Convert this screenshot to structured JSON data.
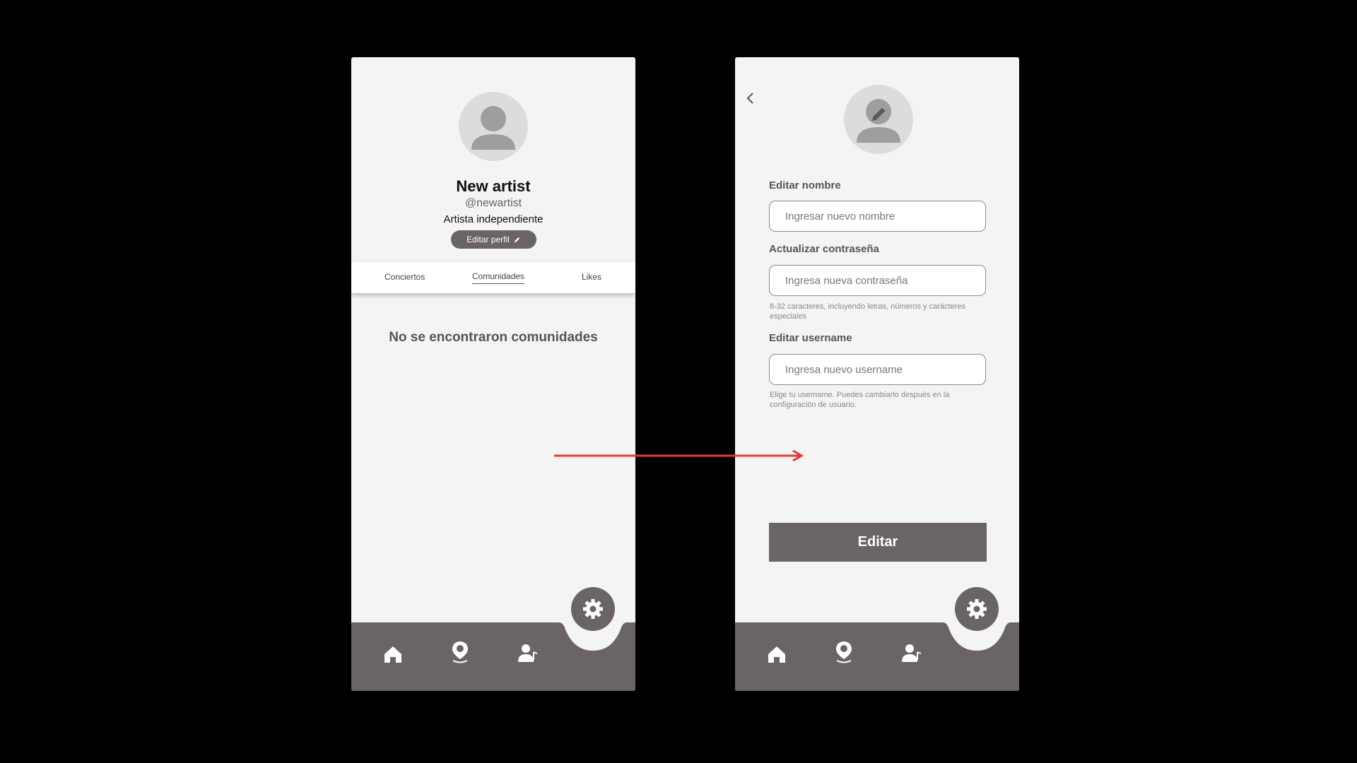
{
  "profile_screen": {
    "name": "New artist",
    "handle": "@newartist",
    "role": "Artista independiente",
    "edit_profile_label": "Editar perfil",
    "tabs": [
      {
        "label": "Conciertos",
        "active": false
      },
      {
        "label": "Comunidades",
        "active": true
      },
      {
        "label": "Likes",
        "active": false
      }
    ],
    "empty_message": "No se encontraron comunidades"
  },
  "edit_screen": {
    "name_label": "Editar nombre",
    "name_placeholder": "Ingresar nuevo nombre",
    "password_label": "Actualizar contraseña",
    "password_placeholder": "Ingresa nueva contraseña",
    "password_hint": "8-32 caracteres, incluyendo letras, números y carácteres especiales",
    "username_label": "Editar username",
    "username_placeholder": "Ingresa nuevo username",
    "username_hint": "Elige tu username. Puedes cambiarlo después en la configuración de usuario.",
    "submit_label": "Editar"
  },
  "nav": {
    "items": [
      "home-icon",
      "location-pin-icon",
      "artist-profile-icon"
    ],
    "fab_icon": "gear-icon"
  },
  "colors": {
    "background": "#000000",
    "screen": "#f4f4f4",
    "primary": "#6b6464",
    "flow_arrow": "#e53935"
  }
}
